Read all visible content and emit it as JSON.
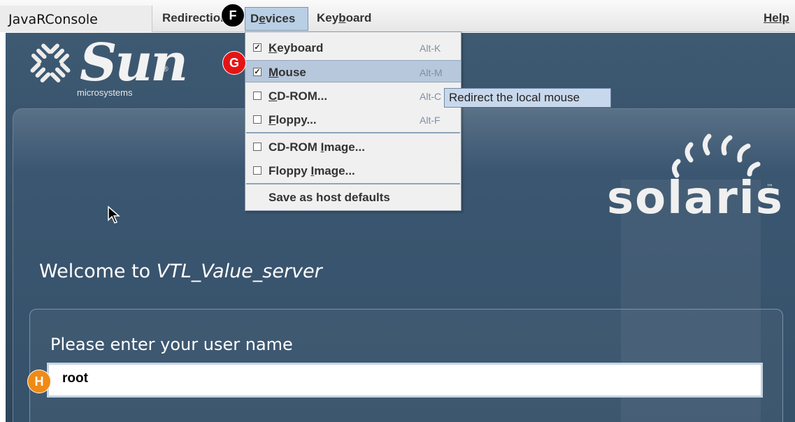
{
  "app": {
    "title": "JavaRConsole"
  },
  "menubar": {
    "redirection": "Redirection",
    "devices_pre": "D",
    "devices_mn": "e",
    "devices_post": "vices",
    "keyboard_pre": "Key",
    "keyboard_mn": "b",
    "keyboard_post": "oard",
    "help": "Help"
  },
  "devices_menu": {
    "items": [
      {
        "mn": "K",
        "rest": "eyboard",
        "accelerator": "Alt-K",
        "checked": true
      },
      {
        "mn": "M",
        "rest": "ouse",
        "accelerator": "Alt-M",
        "checked": true,
        "highlighted": true
      },
      {
        "mn": "C",
        "rest": "D-ROM...",
        "accelerator": "Alt-C",
        "checked": false
      },
      {
        "mn": "F",
        "rest": "loppy...",
        "accelerator": "Alt-F",
        "checked": false
      },
      {
        "pre": "CD-ROM ",
        "mn": "I",
        "rest": "mage...",
        "checked": false
      },
      {
        "pre": "Floppy ",
        "mn": "I",
        "rest": "mage...",
        "checked": false
      },
      {
        "label": "Save as host defaults"
      }
    ]
  },
  "tooltip": "Redirect the local mouse",
  "desktop": {
    "sun_brand": "Sun",
    "sun_sub": "microsystems",
    "solaris_brand": "solaris",
    "welcome_prefix": "Welcome to ",
    "welcome_host": "VTL_Value_server",
    "username_prompt": "Please enter your user name",
    "username_value": "root"
  },
  "badges": {
    "f": "F",
    "g": "G",
    "h": "H"
  },
  "colors": {
    "desktop_bg": "#3e5a73",
    "menu_highlight": "#b7c8dc",
    "tooltip_bg": "#c8d8ec",
    "badge_f": "#000000",
    "badge_g": "#e51414",
    "badge_h": "#f08a15"
  }
}
